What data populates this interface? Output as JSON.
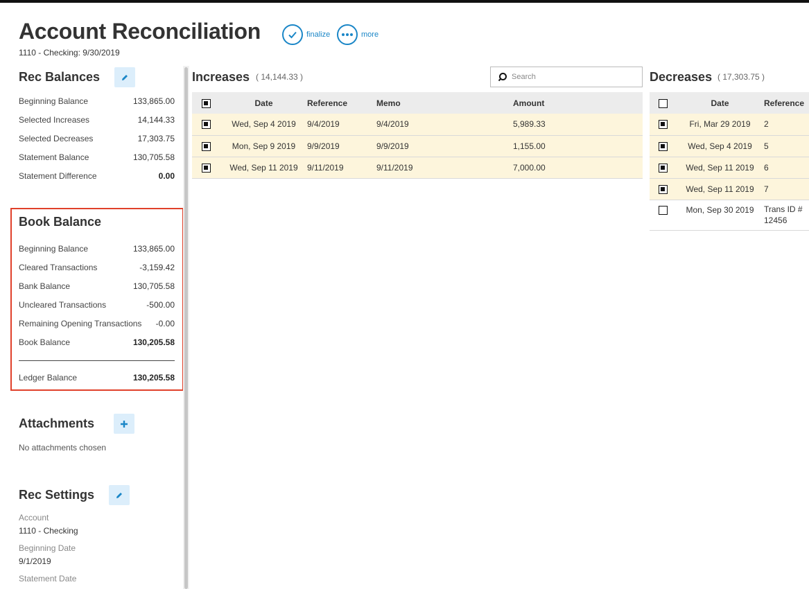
{
  "header": {
    "title": "Account Reconciliation",
    "subtitle": "1110 - Checking: 9/30/2019",
    "finalize_label": "finalize",
    "more_label": "more"
  },
  "rec_balances": {
    "title": "Rec Balances",
    "rows": [
      {
        "label": "Beginning Balance",
        "value": "133,865.00"
      },
      {
        "label": "Selected Increases",
        "value": "14,144.33"
      },
      {
        "label": "Selected Decreases",
        "value": "17,303.75"
      },
      {
        "label": "Statement Balance",
        "value": "130,705.58"
      },
      {
        "label": "Statement Difference",
        "value": "0.00"
      }
    ]
  },
  "book_balance": {
    "title": "Book Balance",
    "rows": [
      {
        "label": "Beginning Balance",
        "value": "133,865.00"
      },
      {
        "label": "Cleared Transactions",
        "value": "-3,159.42"
      },
      {
        "label": "Bank Balance",
        "value": "130,705.58"
      },
      {
        "label": "Uncleared Transactions",
        "value": "-500.00"
      },
      {
        "label": "Remaining Opening Transactions",
        "value": "-0.00"
      },
      {
        "label": "Book Balance",
        "value": "130,205.58"
      }
    ],
    "ledger": {
      "label": "Ledger Balance",
      "value": "130,205.58"
    }
  },
  "attachments": {
    "title": "Attachments",
    "empty_text": "No attachments chosen"
  },
  "rec_settings": {
    "title": "Rec Settings",
    "account_label": "Account",
    "account_value": "1110 - Checking",
    "beginning_date_label": "Beginning Date",
    "beginning_date_value": "9/1/2019",
    "statement_date_label": "Statement Date"
  },
  "increases": {
    "title": "Increases",
    "total": "( 14,144.33 )",
    "search_placeholder": "Search",
    "columns": {
      "date": "Date",
      "reference": "Reference",
      "memo": "Memo",
      "amount": "Amount"
    },
    "rows": [
      {
        "checked": true,
        "date": "Wed, Sep 4 2019",
        "reference": "9/4/2019",
        "memo": "9/4/2019",
        "amount": "5,989.33"
      },
      {
        "checked": true,
        "date": "Mon, Sep 9 2019",
        "reference": "9/9/2019",
        "memo": "9/9/2019",
        "amount": "1,155.00"
      },
      {
        "checked": true,
        "date": "Wed, Sep 11 2019",
        "reference": "9/11/2019",
        "memo": "9/11/2019",
        "amount": "7,000.00"
      }
    ]
  },
  "decreases": {
    "title": "Decreases",
    "total": "( 17,303.75 )",
    "columns": {
      "date": "Date",
      "reference": "Reference"
    },
    "rows": [
      {
        "checked": true,
        "date": "Fri, Mar 29 2019",
        "reference": "2"
      },
      {
        "checked": true,
        "date": "Wed, Sep 4 2019",
        "reference": "5"
      },
      {
        "checked": true,
        "date": "Wed, Sep 11 2019",
        "reference": "6"
      },
      {
        "checked": true,
        "date": "Wed, Sep 11 2019",
        "reference": "7"
      },
      {
        "checked": false,
        "date": "Mon, Sep 30 2019",
        "reference": "Trans ID # 12456"
      }
    ]
  },
  "colors": {
    "accent": "#1a86c7",
    "highlight_row": "#fdf5dc",
    "box_border": "#e0402a"
  }
}
